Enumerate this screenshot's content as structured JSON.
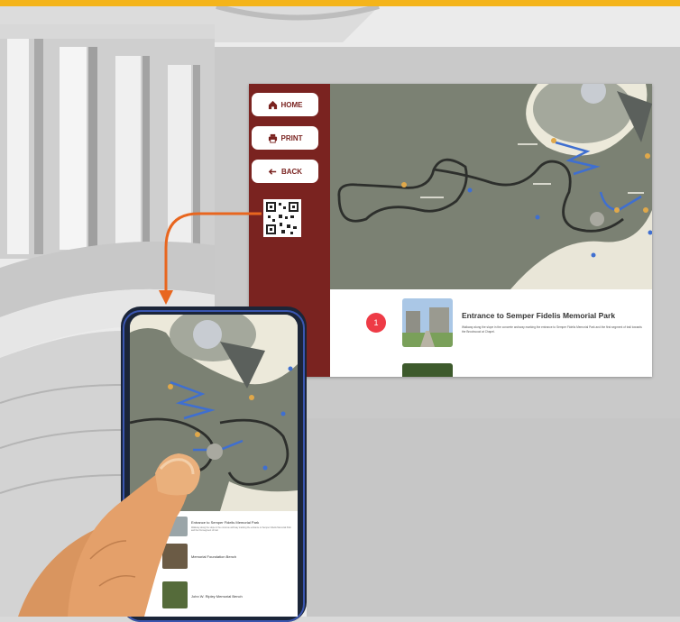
{
  "kiosk": {
    "nav": [
      {
        "label": "HOME",
        "icon": "home-icon"
      },
      {
        "label": "PRINT",
        "icon": "printer-icon"
      },
      {
        "label": "BACK",
        "icon": "back-arrow-icon"
      }
    ],
    "info": {
      "title": "Entrance to Semper Fidelis Memorial Park",
      "description": "Walkway along the slope in the concrete archway marking the entrance to Semper Fidelis Memorial Park and the first segment of trail towards the Brookwood at Chapel.",
      "pin_label": "1"
    }
  },
  "phone": {
    "list": [
      {
        "title": "Entrance to Semper Fidelis Memorial Park",
        "description": "Walkway along the slope in the concrete archway marking the entrance to Semper Fidelis Memorial Park and the first segment of trail."
      },
      {
        "title": "Memorial Foundation Bench"
      },
      {
        "title": "John W. Ripley Memorial Bench"
      }
    ]
  },
  "colors": {
    "accent": "#f4b41a",
    "sidebar": "#7a2320",
    "pin": "#ee3b46",
    "arrow": "#e8661f",
    "trail": "#3f6fd0"
  }
}
